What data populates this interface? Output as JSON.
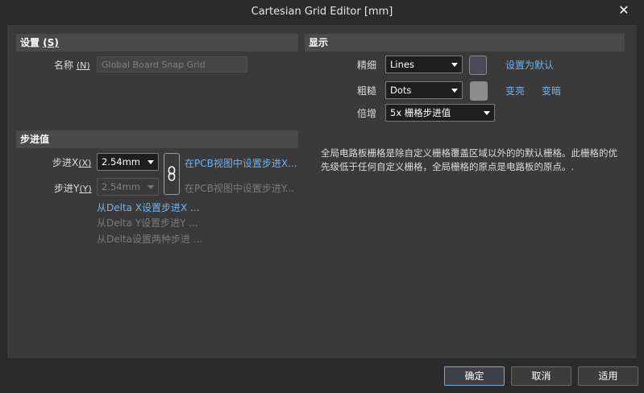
{
  "window": {
    "title": "Cartesian Grid Editor [mm]"
  },
  "settings": {
    "header": "设置",
    "header_key": "(S)",
    "name_label": "名称",
    "name_key": "(N)",
    "name_value": "Global Board Snap Grid"
  },
  "display": {
    "header": "显示",
    "fine_label": "精细",
    "fine_value": "Lines",
    "fine_color": "#4a4a54",
    "coarse_label": "粗糙",
    "coarse_value": "Dots",
    "coarse_color": "#8c8c8c",
    "multiplier_label": "倍增",
    "multiplier_value": "5x 栅格步进值",
    "set_default_link": "设置为默认",
    "lighter_link": "变亮",
    "darker_link": "变暗"
  },
  "step": {
    "header": "步进值",
    "step_x_label": "步进X",
    "step_x_key": "(X)",
    "step_x_value": "2.54mm",
    "step_y_label": "步进Y",
    "step_y_key": "(Y)",
    "step_y_value": "2.54mm",
    "pcb_set_x_link": "在PCB视图中设置步进X...",
    "pcb_set_y_link": "在PCB视图中设置步进Y...",
    "delta_x_link": "从Delta X设置步进X ...",
    "delta_y_link": "从Delta Y设置步进Y ...",
    "delta_both_link": "从Delta设置两种步进 ..."
  },
  "description": "全局电路板栅格是除自定义栅格覆盖区域以外的的默认栅格。此栅格的优先级低于任何自定义栅格，全局栅格的原点是电路板的原点。.",
  "buttons": {
    "ok": "确定",
    "cancel": "取消",
    "apply": "适用"
  },
  "icons": {
    "close": "close-icon",
    "link": "chain-link-icon",
    "dropdown": "chevron-down-icon"
  }
}
